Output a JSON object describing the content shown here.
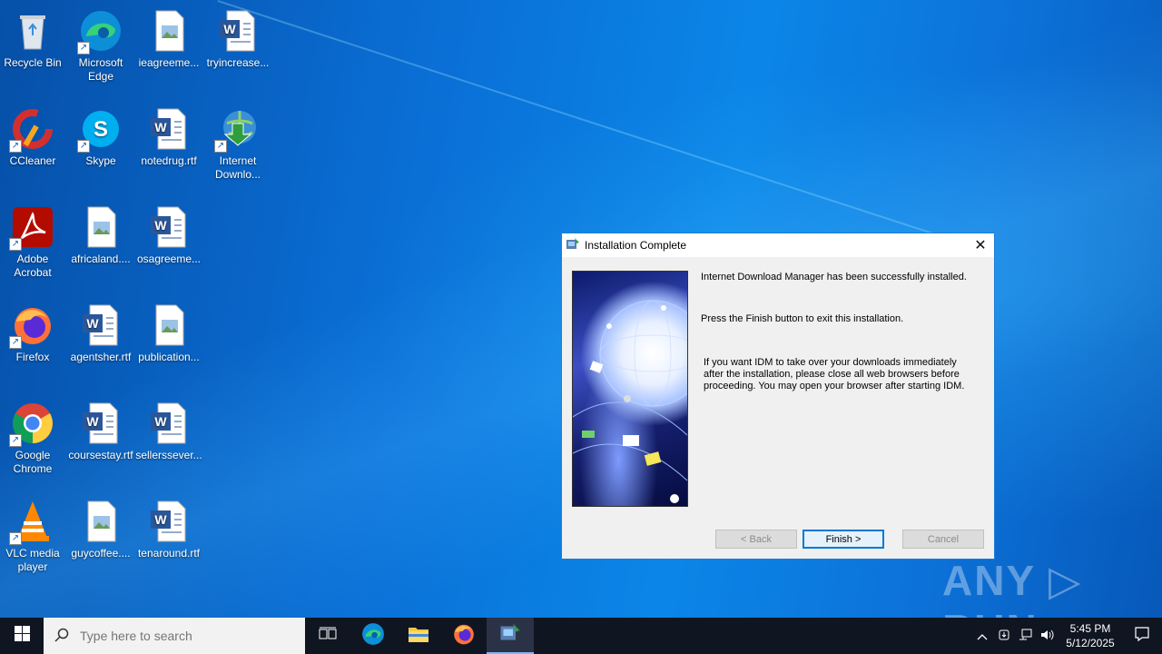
{
  "desktop": {
    "icons": [
      {
        "label": "Recycle Bin"
      },
      {
        "label": "Microsoft Edge"
      },
      {
        "label": "ieagreeme..."
      },
      {
        "label": "tryincrease..."
      },
      {
        "label": "CCleaner"
      },
      {
        "label": "Skype"
      },
      {
        "label": "notedrug.rtf"
      },
      {
        "label": "Internet Downlo..."
      },
      {
        "label": "Adobe Acrobat"
      },
      {
        "label": "africaland...."
      },
      {
        "label": "osagreeme..."
      },
      {
        "label": "Firefox"
      },
      {
        "label": "agentsher.rtf"
      },
      {
        "label": "publication..."
      },
      {
        "label": "Google Chrome"
      },
      {
        "label": "coursestay.rtf"
      },
      {
        "label": "sellerssever..."
      },
      {
        "label": "VLC media player"
      },
      {
        "label": "guycoffee...."
      },
      {
        "label": "tenaround.rtf"
      }
    ]
  },
  "dialog": {
    "title": "Installation Complete",
    "message1": "Internet Download Manager has been successfully installed.",
    "message2": "Press the Finish button to exit this installation.",
    "message3": "If you want IDM to take over your downloads immediately after the installation, please close all web browsers before proceeding. You may open your browser after starting IDM.",
    "back_label": "< Back",
    "finish_label": "Finish >",
    "cancel_label": "Cancel"
  },
  "watermark": "ANY ▷ RUN",
  "taskbar": {
    "search_placeholder": "Type here to search",
    "time": "5:45 PM",
    "date": "5/12/2025"
  },
  "colors": {
    "accent": "#0078d7",
    "taskbar": "#101522",
    "desktop": "#0a6fd6"
  }
}
